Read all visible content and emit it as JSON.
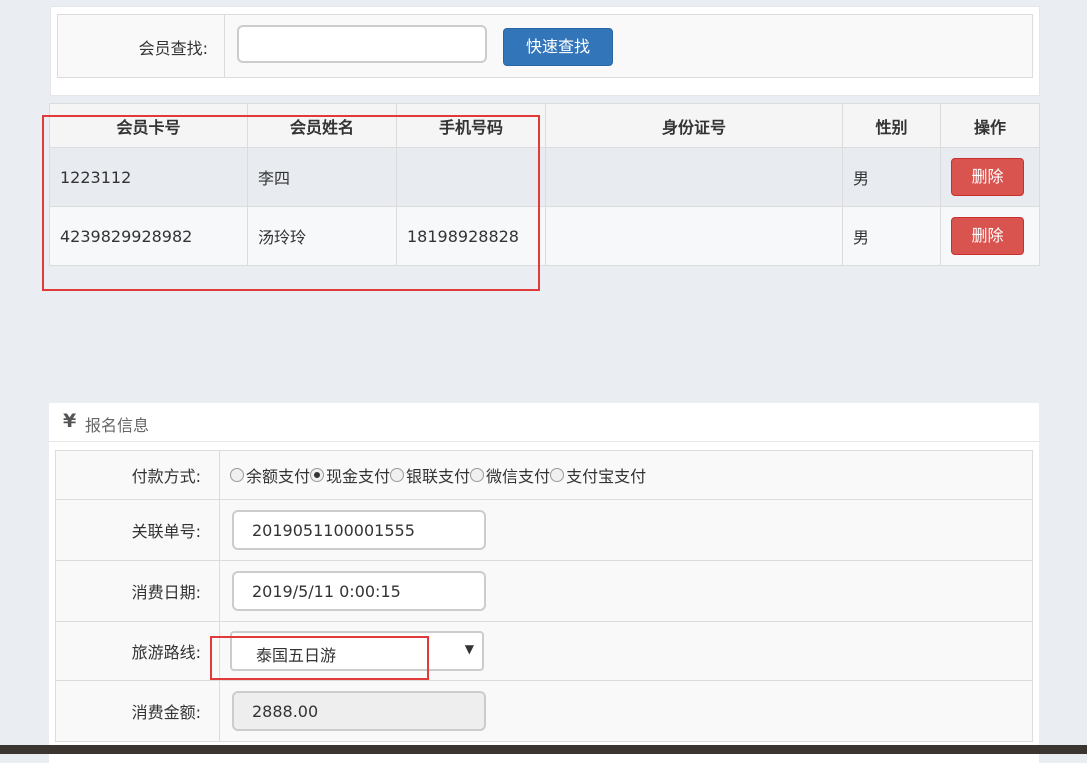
{
  "search": {
    "label": "会员查找:",
    "value": "",
    "button_label": "快速查找"
  },
  "members_table": {
    "headers": [
      "会员卡号",
      "会员姓名",
      "手机号码",
      "身份证号",
      "性别",
      "操作"
    ],
    "rows": [
      {
        "card_no": "1223112",
        "name": "李四",
        "phone": "",
        "id_no": "",
        "gender": "男",
        "action": "删除"
      },
      {
        "card_no": "4239829928982",
        "name": "汤玲玲",
        "phone": "18198928828",
        "id_no": "",
        "gender": "男",
        "action": "删除"
      }
    ]
  },
  "registration": {
    "icon": "yen-icon",
    "title": "报名信息",
    "payment": {
      "label": "付款方式:",
      "options": [
        "余额支付",
        "现金支付",
        "银联支付",
        "微信支付",
        "支付宝支付"
      ],
      "selected": "现金支付"
    },
    "order_no": {
      "label": "关联单号:",
      "value": "2019051100001555"
    },
    "date": {
      "label": "消费日期:",
      "value": "2019/5/11 0:00:15"
    },
    "route": {
      "label": "旅游路线:",
      "value": "泰国五日游"
    },
    "amount": {
      "label": "消费金额:",
      "value": "2888.00"
    }
  },
  "colors": {
    "primary_button": "#3375b9",
    "danger_button": "#d9534f",
    "highlight_box": "#e03a3a",
    "page_background": "#eaedf2"
  }
}
